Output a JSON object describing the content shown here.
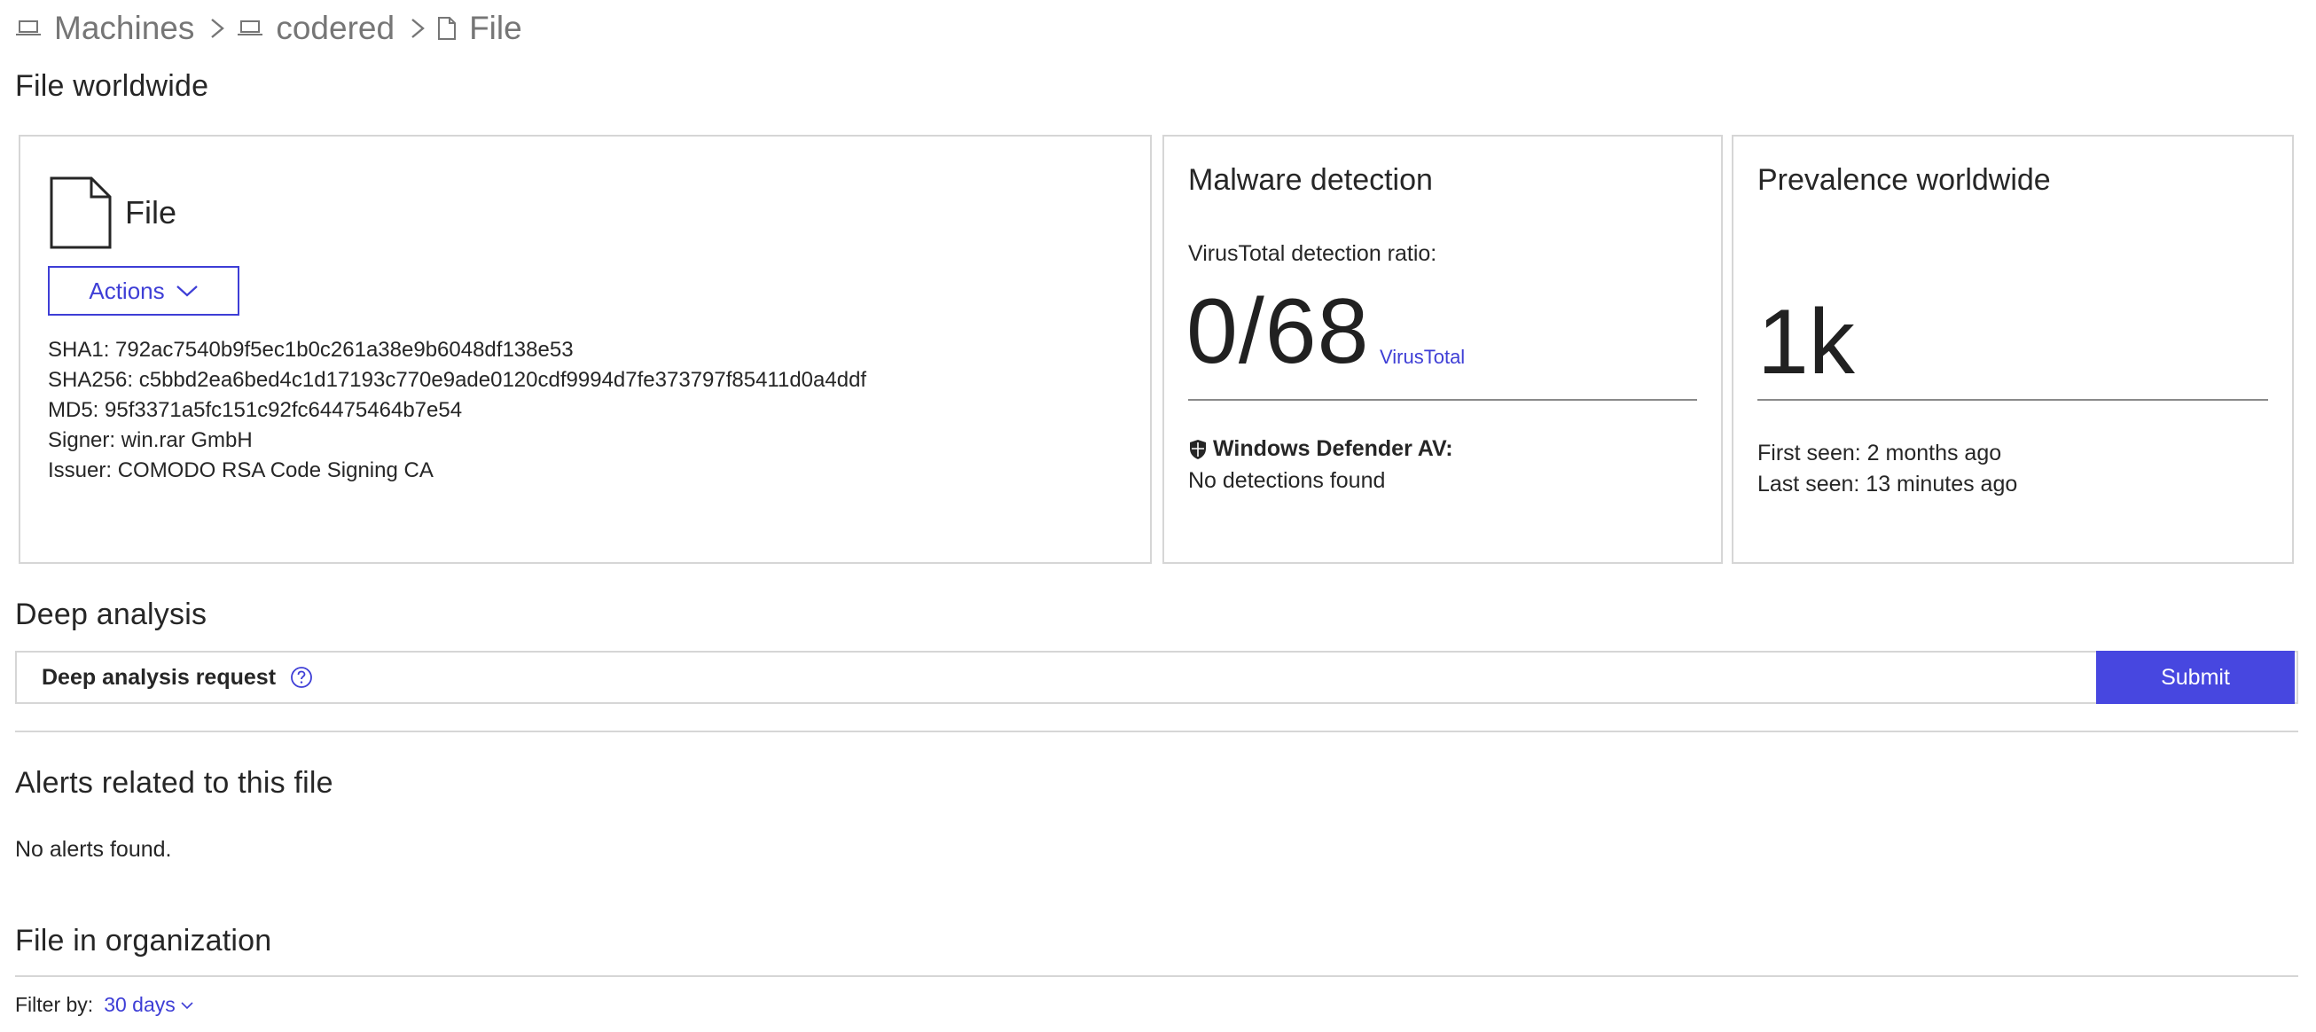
{
  "breadcrumb": {
    "items": [
      {
        "label": "Machines",
        "icon": "laptop-icon"
      },
      {
        "label": "codered",
        "icon": "laptop-icon"
      },
      {
        "label": "File",
        "icon": "file-icon"
      }
    ]
  },
  "file_worldwide": {
    "title": "File worldwide",
    "file_card": {
      "file_name": "File",
      "actions_label": "Actions",
      "sha1": "SHA1: 792ac7540b9f5ec1b0c261a38e9b6048df138e53",
      "sha256": "SHA256: c5bbd2ea6bed4c1d17193c770e9ade0120cdf9994d7fe373797f85411d0a4ddf",
      "md5": "MD5: 95f3371a5fc151c92fc64475464b7e54",
      "signer": "Signer: win.rar GmbH",
      "issuer": "Issuer: COMODO RSA Code Signing CA"
    },
    "malware_card": {
      "title": "Malware detection",
      "vt_label": "VirusTotal detection ratio:",
      "vt_ratio": "0/68",
      "vt_link": "VirusTotal",
      "wd_label": "Windows Defender AV:",
      "wd_status": "No detections found"
    },
    "prevalence_card": {
      "title": "Prevalence worldwide",
      "count": "1k",
      "first_seen": "First seen: 2 months ago",
      "last_seen": "Last seen: 13 minutes ago"
    }
  },
  "deep_analysis": {
    "title": "Deep analysis",
    "request_label": "Deep analysis request",
    "submit_label": "Submit"
  },
  "alerts": {
    "title": "Alerts related to this file",
    "empty_text": "No alerts found."
  },
  "file_in_org": {
    "title": "File in organization",
    "filter_label": "Filter by:",
    "filter_value": "30 days"
  },
  "colors": {
    "accent": "#3e3ed6",
    "submit_bg": "#4747e0",
    "border": "#d6d6d6",
    "muted": "#767676"
  }
}
